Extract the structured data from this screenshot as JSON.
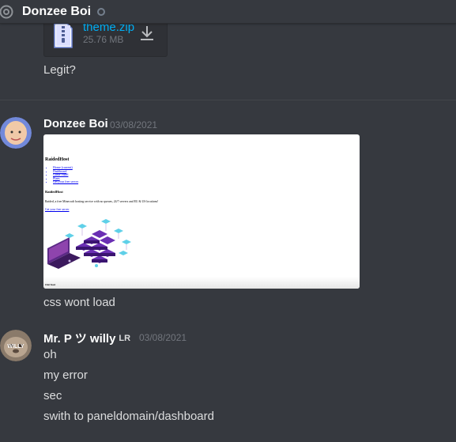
{
  "header": {
    "title": "Donzee Boi",
    "at_icon": "at-icon",
    "status": "offline"
  },
  "attachment": {
    "filename": "theme.zip",
    "size": "25.76 MB",
    "icon": "zip-file-icon",
    "download_icon": "download-icon"
  },
  "messages": {
    "legit": "Legit?",
    "donzee": {
      "username": "Donzee Boi",
      "timestamp": "03/08/2021",
      "caption": "css wont load"
    },
    "mrp": {
      "username": "Mr. P ツ willy",
      "badge": "LR",
      "timestamp": "03/08/2021",
      "lines": [
        "oh",
        "my error",
        "sec",
        "swith to paneldomain/dashboard"
      ]
    }
  },
  "embed_preview": {
    "title": "RaidedHost",
    "nav": [
      "Home (current)",
      "Dashboard",
      "Game Panel",
      "Plans",
      "Get your free server"
    ],
    "subtitle": "RaidedHost",
    "description": "Raided, a free Minecraft hosting service with no queues, 24/7 servers and EU & US locations!",
    "link": "Get your free server",
    "footer": "Our host"
  },
  "colors": {
    "background": "#36393f",
    "link": "#00aff4",
    "muted": "#72767d",
    "text": "#dcddde"
  }
}
